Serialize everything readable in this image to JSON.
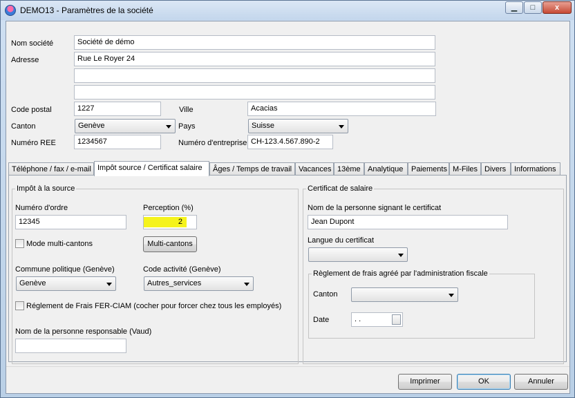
{
  "window": {
    "title": "DEMO13 - Paramètres de la société",
    "controls": {
      "minimize": "▁",
      "maximize": "□",
      "close": "x"
    }
  },
  "company": {
    "name_label": "Nom société",
    "name_value": "Société de démo",
    "address_label": "Adresse",
    "address_line1": "Rue Le Royer 24",
    "address_line2": "",
    "address_line3": "",
    "postal_code_label": "Code postal",
    "postal_code_value": "1227",
    "city_label": "Ville",
    "city_value": "Acacias",
    "canton_label": "Canton",
    "canton_value": "Genève",
    "country_label": "Pays",
    "country_value": "Suisse",
    "ree_label": "Numéro REE",
    "ree_value": "1234567",
    "enterprise_label": "Numéro d'entreprise",
    "enterprise_value": "CH-123.4.567.890-2"
  },
  "tabs": [
    "Téléphone / fax / e-mail",
    "Impôt source / Certificat salaire",
    "Âges / Temps de travail",
    "Vacances",
    "13ème",
    "Analytique",
    "Paiements",
    "M-Files",
    "Divers",
    "Informations"
  ],
  "active_tab": "Impôt source / Certificat salaire",
  "impot": {
    "group_title": "Impôt à la source",
    "order_label": "Numéro d'ordre",
    "order_value": "12345",
    "perception_label": "Perception (%)",
    "perception_value": "2",
    "multi_cantons_checkbox_label": "Mode multi-cantons",
    "multi_cantons_button": "Multi-cantons",
    "commune_label": "Commune politique (Genève)",
    "commune_value": "Genève",
    "activity_label": "Code activité (Genève)",
    "activity_value": "Autres_services",
    "fer_ciam_label": "Réglement de Frais FER-CIAM (cocher pour forcer chez tous les employés)",
    "responsible_label": "Nom de la personne responsable (Vaud)",
    "responsible_value": ""
  },
  "certificat": {
    "group_title": "Certificat de salaire",
    "signer_label": "Nom de la personne signant le certificat",
    "signer_value": "Jean Dupont",
    "language_label": "Langue du certificat",
    "language_value": "",
    "reglement_group_title": "Règlement de frais agréé par l'administration fiscale",
    "canton_label": "Canton",
    "canton_value": "",
    "date_label": "Date",
    "date_value": " .  ."
  },
  "footer": {
    "print_button": "Imprimer",
    "ok_button": "OK",
    "cancel_button": "Annuler"
  },
  "colors": {
    "highlight": "#f5f31c",
    "titlebar": "#c3d6ec",
    "close_button": "#c74a35"
  }
}
